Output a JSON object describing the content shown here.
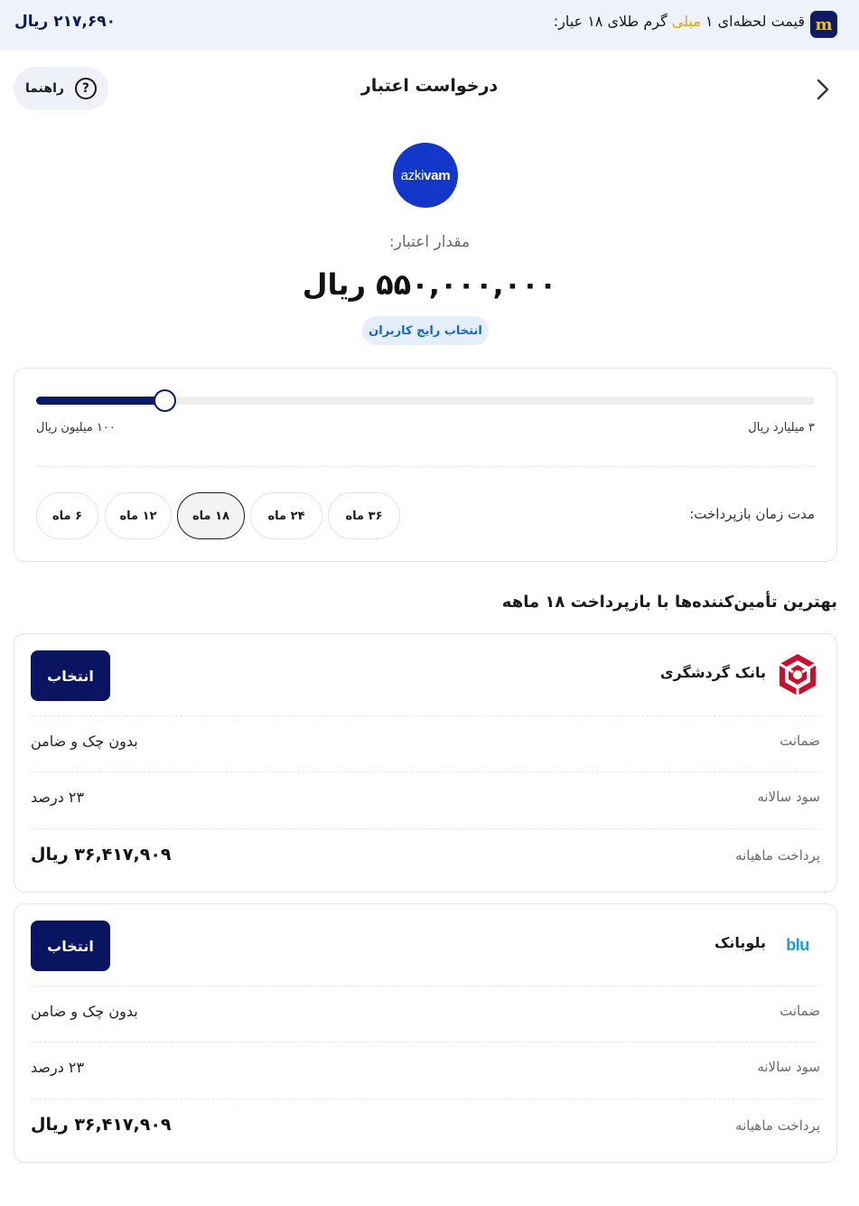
{
  "topbar": {
    "price": "۲۱۷,۶۹۰ ریال",
    "message_prefix": "قیمت لحظه‌ای ۱ ",
    "message_accent": "میلی",
    "message_suffix": " گرم طلای ۱۸ عیار:",
    "logo_letter": "m",
    "accent_color": "#e8a300"
  },
  "header": {
    "title": "درخواست اعتبار",
    "guide_label": "راهنما",
    "guide_icon": "?"
  },
  "credit": {
    "logo_text_light": "azki",
    "logo_text_bold": "vam",
    "label": "مقدار اعتبار:",
    "amount": "۵۵۰,۰۰۰,۰۰۰ ریال",
    "badge": "انتخاب رایج کاربران"
  },
  "slider": {
    "min_label": "۱۰۰ میلیون ریال",
    "max_label": "۳ میلیارد ریال",
    "value_fraction": 0.165
  },
  "term": {
    "label": "مدت زمان بازپرداخت:",
    "options": [
      "۳۶ ماه",
      "۲۴ ماه",
      "۱۸ ماه",
      "۱۲ ماه",
      "۶ ماه"
    ],
    "selected": "۱۸ ماه"
  },
  "providers_title": "بهترین تأمین‌کننده‌ها با بازپرداخت ۱۸ ماهه",
  "providers": [
    {
      "name": "بانک گردشگری",
      "select_label": "انتخاب",
      "guarantee_label": "ضمانت",
      "guarantee_value": "بدون چک و ضامن",
      "interest_label": "سود سالانه",
      "interest_value": "۲۳ درصد",
      "monthly_label": "پرداخت ماهیانه",
      "monthly_value": "۳۶,۴۱۷,۹۰۹ ریال",
      "logo_icon": "tourism-bank-logo"
    },
    {
      "name": "بلوبانک",
      "select_label": "انتخاب",
      "guarantee_label": "ضمانت",
      "guarantee_value": "بدون چک و ضامن",
      "interest_label": "سود سالانه",
      "interest_value": "۲۳ درصد",
      "monthly_label": "پرداخت ماهیانه",
      "monthly_value": "۳۶,۴۱۷,۹۰۹ ریال",
      "logo_text": "blu"
    }
  ],
  "colors": {
    "primary": "#0a1561",
    "badge_text": "#1565c8",
    "badge_bg": "#e5eefc",
    "topbar_bg": "#eef2fb",
    "azki_blue": "#1337c8",
    "tourism_red": "#c8102e"
  }
}
